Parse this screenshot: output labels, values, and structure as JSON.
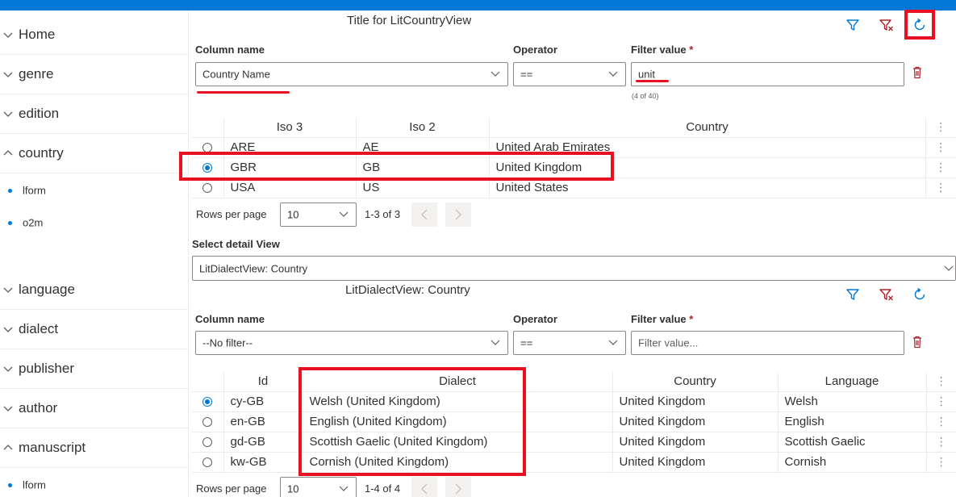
{
  "sidebar": {
    "items": [
      {
        "label": "Home",
        "expanded": false
      },
      {
        "label": "genre",
        "expanded": false
      },
      {
        "label": "edition",
        "expanded": false
      },
      {
        "label": "country",
        "expanded": true
      },
      {
        "label": "language",
        "expanded": false
      },
      {
        "label": "dialect",
        "expanded": false
      },
      {
        "label": "publisher",
        "expanded": false
      },
      {
        "label": "author",
        "expanded": false
      },
      {
        "label": "manuscript",
        "expanded": true
      }
    ],
    "country_subitems": [
      "lform",
      "o2m"
    ],
    "manuscript_subitems": [
      "lform"
    ]
  },
  "master": {
    "title": "Title for LitCountryView",
    "icons": [
      "filter-icon",
      "clear-filter-icon",
      "refresh-icon"
    ],
    "filter": {
      "column_label": "Column name",
      "column_value": "Country Name",
      "operator_label": "Operator",
      "operator_value": "==",
      "value_label": "Filter value",
      "required_mark": "*",
      "value": "unit",
      "count_hint": "(4 of 40)"
    },
    "table": {
      "headers": [
        "Iso 3",
        "Iso 2",
        "Country"
      ],
      "rows": [
        {
          "iso3": "ARE",
          "iso2": "AE",
          "country": "United Arab Emirates",
          "selected": false
        },
        {
          "iso3": "GBR",
          "iso2": "GB",
          "country": "United Kingdom",
          "selected": true
        },
        {
          "iso3": "USA",
          "iso2": "US",
          "country": "United States",
          "selected": false
        }
      ],
      "menu_glyph": "⋮"
    },
    "pager": {
      "rows_per_page_label": "Rows per page",
      "rows_per_page": "10",
      "range": "1-3 of 3"
    }
  },
  "detail_select": {
    "label": "Select detail View",
    "value": "LitDialectView: Country"
  },
  "detail": {
    "title": "LitDialectView: Country",
    "filter": {
      "column_label": "Column name",
      "column_value": "--No filter--",
      "operator_label": "Operator",
      "operator_value": "==",
      "value_label": "Filter value",
      "required_mark": "*",
      "value_placeholder": "Filter value..."
    },
    "table": {
      "headers": [
        "Id",
        "Dialect",
        "Country",
        "Language"
      ],
      "rows": [
        {
          "id": "cy-GB",
          "dialect": "Welsh (United Kingdom)",
          "country": "United Kingdom",
          "language": "Welsh",
          "selected": true
        },
        {
          "id": "en-GB",
          "dialect": "English (United Kingdom)",
          "country": "United Kingdom",
          "language": "English",
          "selected": false
        },
        {
          "id": "gd-GB",
          "dialect": "Scottish Gaelic (United Kingdom)",
          "country": "United Kingdom",
          "language": "Scottish Gaelic",
          "selected": false
        },
        {
          "id": "kw-GB",
          "dialect": "Cornish (United Kingdom)",
          "country": "United Kingdom",
          "language": "Cornish",
          "selected": false
        }
      ],
      "menu_glyph": "⋮"
    },
    "pager": {
      "rows_per_page_label": "Rows per page",
      "rows_per_page": "10",
      "range": "1-4 of 4"
    }
  },
  "colors": {
    "accent": "#0078d4",
    "highlight": "#e81123",
    "danger": "#a4262c"
  }
}
